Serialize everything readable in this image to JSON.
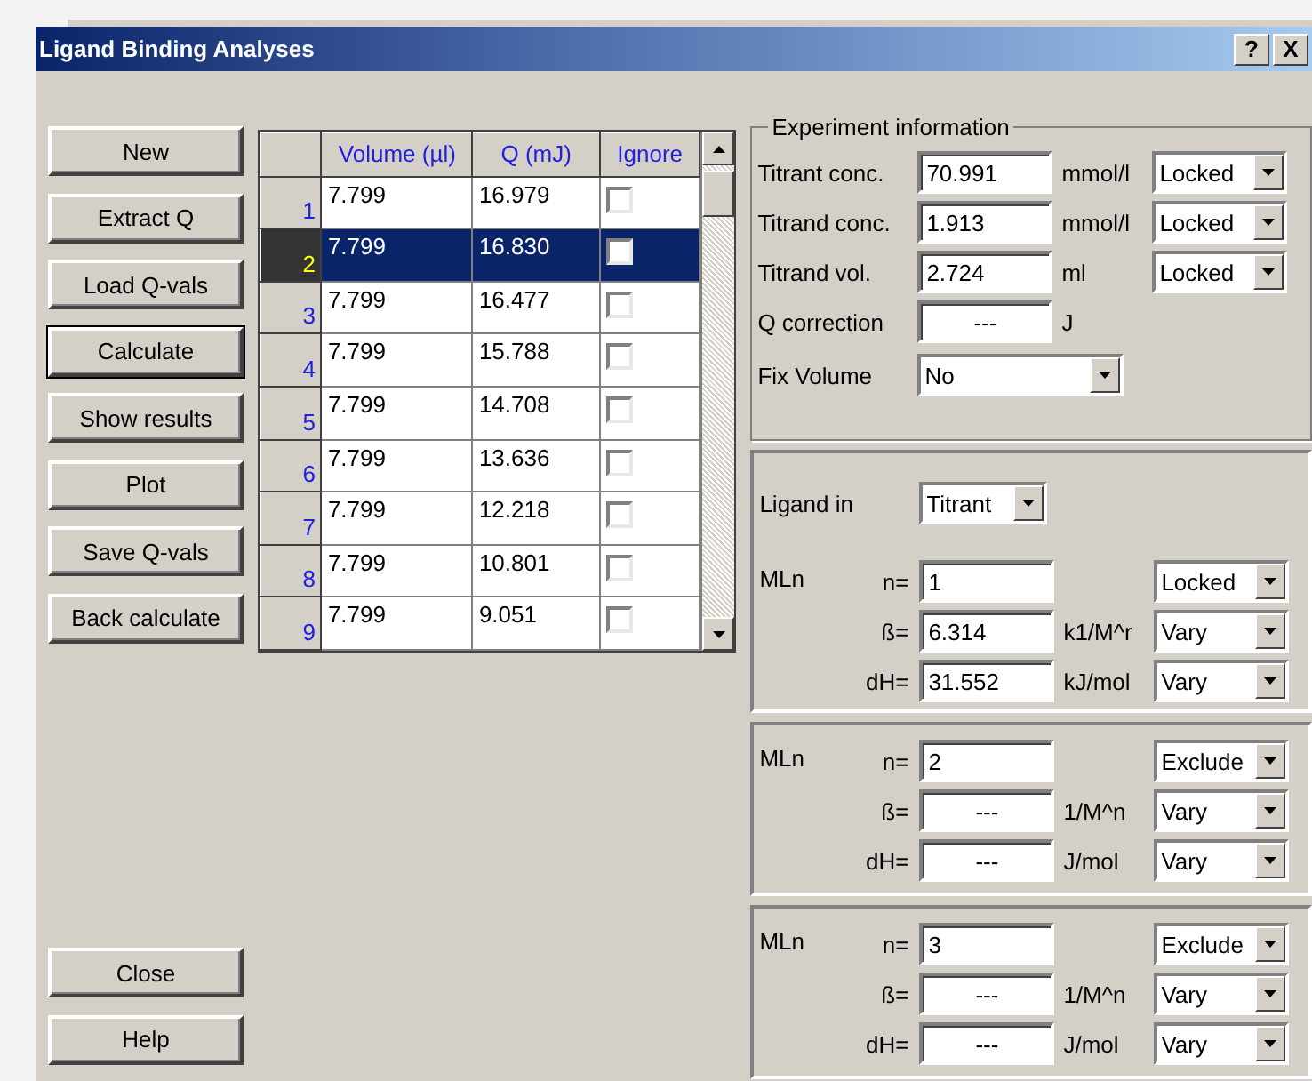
{
  "window": {
    "title": "Ligand Binding Analyses",
    "title_buttons": [
      "?",
      "X"
    ]
  },
  "actions": [
    {
      "label": "New",
      "focused": false
    },
    {
      "label": "Extract Q",
      "focused": false
    },
    {
      "label": "Load Q-vals",
      "focused": false
    },
    {
      "label": "Calculate",
      "focused": true
    },
    {
      "label": "Show results",
      "focused": false
    },
    {
      "label": "Plot",
      "focused": false
    },
    {
      "label": "Save Q-vals",
      "focused": false
    },
    {
      "label": "Back calculate",
      "focused": false
    }
  ],
  "bottom_buttons": [
    "Close",
    "Help"
  ],
  "grid": {
    "columns": [
      "Volume (µl)",
      "Q (mJ)",
      "Ignore"
    ],
    "rows": [
      {
        "index": "1",
        "volume": "7.799",
        "q": "16.979",
        "ignore": false,
        "selected": false
      },
      {
        "index": "2",
        "volume": "7.799",
        "q": "16.830",
        "ignore": false,
        "selected": true
      },
      {
        "index": "3",
        "volume": "7.799",
        "q": "16.477",
        "ignore": false,
        "selected": false
      },
      {
        "index": "4",
        "volume": "7.799",
        "q": "15.788",
        "ignore": false,
        "selected": false
      },
      {
        "index": "5",
        "volume": "7.799",
        "q": "14.708",
        "ignore": false,
        "selected": false
      },
      {
        "index": "6",
        "volume": "7.799",
        "q": "13.636",
        "ignore": false,
        "selected": false
      },
      {
        "index": "7",
        "volume": "7.799",
        "q": "12.218",
        "ignore": false,
        "selected": false
      },
      {
        "index": "8",
        "volume": "7.799",
        "q": "10.801",
        "ignore": false,
        "selected": false
      },
      {
        "index": "9",
        "volume": "7.799",
        "q": "9.051",
        "ignore": false,
        "selected": false
      }
    ]
  },
  "experiment": {
    "title": "Experiment information",
    "fields": [
      {
        "label": "Titrant conc.",
        "kind": "number",
        "value": "70.991",
        "unit": "mmol/l",
        "mode": "Locked"
      },
      {
        "label": "Titrand conc.",
        "kind": "number",
        "value": "1.913",
        "unit": "mmol/l",
        "mode": "Locked"
      },
      {
        "label": "Titrand vol.",
        "kind": "number",
        "value": "2.724",
        "unit": "ml",
        "mode": "Locked"
      },
      {
        "label": "Q correction",
        "kind": "unset",
        "value": "---",
        "unit": "J"
      }
    ],
    "fix_volume": {
      "label": "Fix Volume",
      "value": "No"
    }
  },
  "ligand_in": {
    "label": "Ligand in",
    "value": "Titrant"
  },
  "species": [
    {
      "label": "MLn",
      "rows": [
        {
          "label": "n=",
          "kind": "number",
          "value": "1",
          "mode": "Locked"
        },
        {
          "label": "ß=",
          "kind": "number",
          "value": "6.314",
          "unit": "k1/M^r",
          "mode": "Vary"
        },
        {
          "label": "dH=",
          "kind": "number",
          "value": "31.552",
          "unit": "kJ/mol",
          "mode": "Vary"
        }
      ]
    },
    {
      "label": "MLn",
      "rows": [
        {
          "label": "n=",
          "kind": "number",
          "value": "2",
          "mode": "Exclude"
        },
        {
          "label": "ß=",
          "kind": "unset",
          "value": "---",
          "unit": "1/M^n",
          "mode": "Vary"
        },
        {
          "label": "dH=",
          "kind": "unset",
          "value": "---",
          "unit": "J/mol",
          "mode": "Vary"
        }
      ]
    },
    {
      "label": "MLn",
      "rows": [
        {
          "label": "n=",
          "kind": "number",
          "value": "3",
          "mode": "Exclude"
        },
        {
          "label": "ß=",
          "kind": "unset",
          "value": "---",
          "unit": "1/M^n",
          "mode": "Vary"
        },
        {
          "label": "dH=",
          "kind": "unset",
          "value": "---",
          "unit": "J/mol",
          "mode": "Vary"
        }
      ]
    }
  ]
}
